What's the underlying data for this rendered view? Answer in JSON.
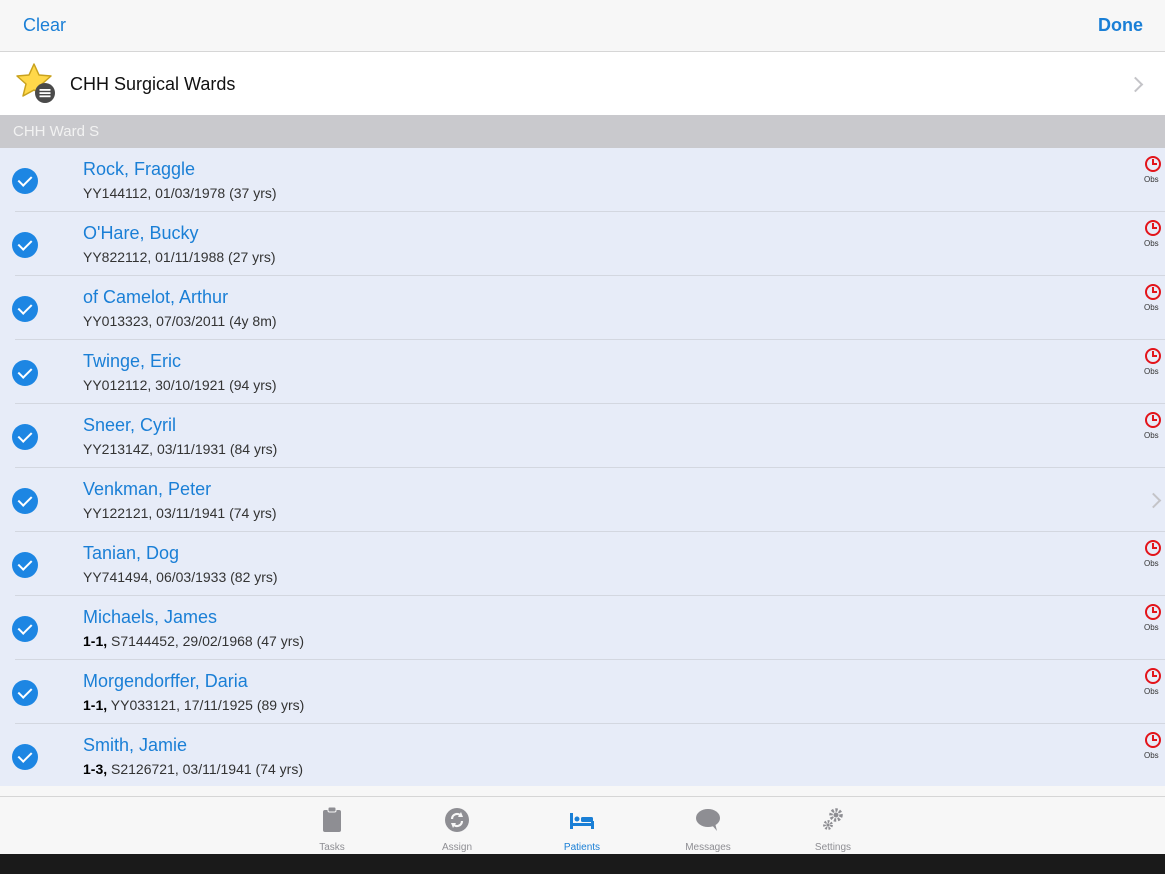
{
  "navbar": {
    "left_label": "Clear",
    "right_label": "Done"
  },
  "ward_selector": {
    "label": "CHH Surgical Wards",
    "icon": "star-list-icon"
  },
  "section": {
    "title": "CHH Ward S"
  },
  "patients": [
    {
      "name": "Rock, Fraggle",
      "prefix": "",
      "detail": "YY144112, 01/03/1978 (37 yrs)",
      "status": "obs",
      "status_label": "Obs"
    },
    {
      "name": "O'Hare, Bucky",
      "prefix": "",
      "detail": "YY822112, 01/11/1988 (27 yrs)",
      "status": "obs",
      "status_label": "Obs"
    },
    {
      "name": "of Camelot, Arthur",
      "prefix": "",
      "detail": "YY013323, 07/03/2011 (4y 8m)",
      "status": "obs",
      "status_label": "Obs"
    },
    {
      "name": "Twinge, Eric",
      "prefix": "",
      "detail": "YY012112, 30/10/1921 (94 yrs)",
      "status": "obs",
      "status_label": "Obs"
    },
    {
      "name": "Sneer, Cyril",
      "prefix": "",
      "detail": "YY21314Z, 03/11/1931 (84 yrs)",
      "status": "obs",
      "status_label": "Obs"
    },
    {
      "name": "Venkman, Peter",
      "prefix": "",
      "detail": "YY122121, 03/11/1941 (74 yrs)",
      "status": "chevron",
      "status_label": ""
    },
    {
      "name": "Tanian, Dog",
      "prefix": "",
      "detail": "YY741494, 06/03/1933 (82 yrs)",
      "status": "obs",
      "status_label": "Obs"
    },
    {
      "name": "Michaels, James",
      "prefix": "1-1,",
      "detail": " S7144452, 29/02/1968 (47 yrs)",
      "status": "obs",
      "status_label": "Obs"
    },
    {
      "name": "Morgendorffer, Daria",
      "prefix": "1-1,",
      "detail": " YY033121, 17/11/1925 (89 yrs)",
      "status": "obs",
      "status_label": "Obs"
    },
    {
      "name": "Smith, Jamie",
      "prefix": "1-3,",
      "detail": " S2126721, 03/11/1941 (74 yrs)",
      "status": "obs",
      "status_label": "Obs"
    }
  ],
  "tabs": [
    {
      "label": "Tasks",
      "icon": "clipboard-icon",
      "active": false
    },
    {
      "label": "Assign",
      "icon": "assign-icon",
      "active": false
    },
    {
      "label": "Patients",
      "icon": "bed-icon",
      "active": true
    },
    {
      "label": "Messages",
      "icon": "speech-bubble-icon",
      "active": false
    },
    {
      "label": "Settings",
      "icon": "gears-icon",
      "active": false
    }
  ],
  "colors": {
    "accent": "#1a7fd6",
    "alert": "#e3141b",
    "list_background": "#e7ecf8",
    "section_header": "#c9c9cd"
  }
}
